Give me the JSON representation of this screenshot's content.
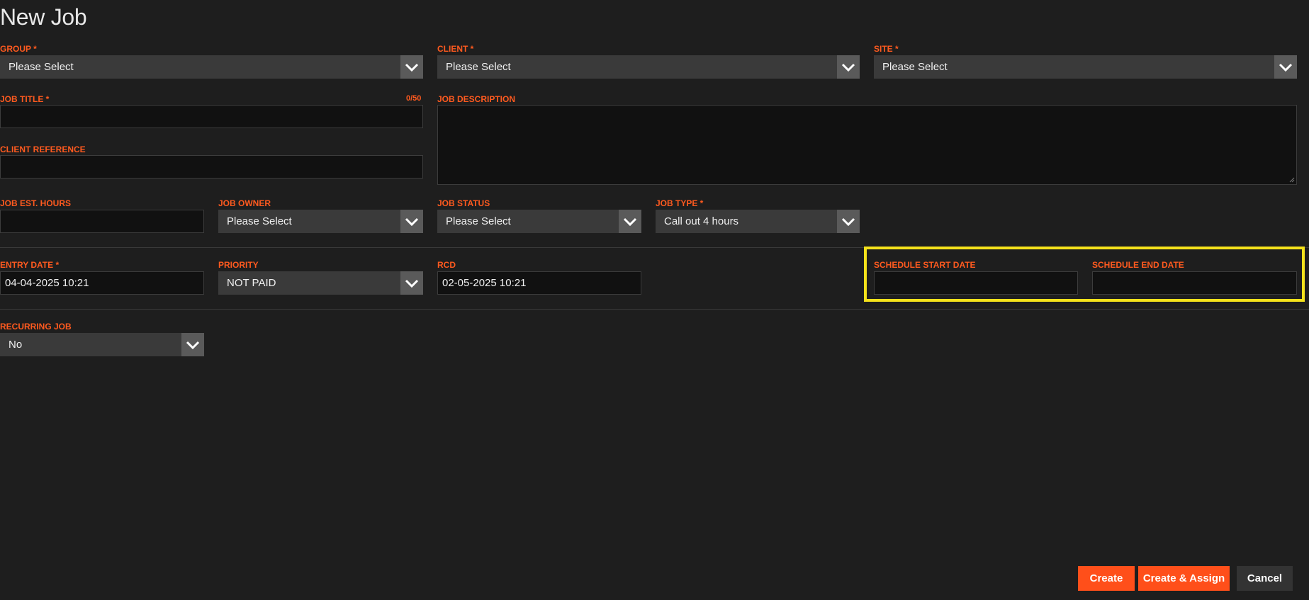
{
  "page": {
    "title": "New Job"
  },
  "fields": {
    "group": {
      "label": "GROUP *",
      "value": "Please Select"
    },
    "client": {
      "label": "CLIENT *",
      "value": "Please Select"
    },
    "site": {
      "label": "SITE *",
      "value": "Please Select"
    },
    "job_title": {
      "label": "JOB TITLE *",
      "counter": "0/50",
      "value": ""
    },
    "job_description": {
      "label": "JOB DESCRIPTION",
      "value": ""
    },
    "client_reference": {
      "label": "CLIENT REFERENCE",
      "value": ""
    },
    "job_est_hours": {
      "label": "JOB EST. HOURS",
      "value": ""
    },
    "job_owner": {
      "label": "JOB OWNER",
      "value": "Please Select"
    },
    "job_status": {
      "label": "JOB STATUS",
      "value": "Please Select"
    },
    "job_type": {
      "label": "JOB TYPE *",
      "value": "Call out 4 hours"
    },
    "entry_date": {
      "label": "ENTRY DATE *",
      "value": "04-04-2025 10:21"
    },
    "priority": {
      "label": "PRIORITY",
      "value": "NOT PAID"
    },
    "rcd": {
      "label": "RCD",
      "value": "02-05-2025 10:21"
    },
    "schedule_start_date": {
      "label": "SCHEDULE START DATE",
      "value": ""
    },
    "schedule_end_date": {
      "label": "SCHEDULE END DATE",
      "value": ""
    },
    "recurring_job": {
      "label": "RECURRING JOB",
      "value": "No"
    }
  },
  "actions": {
    "create": "Create",
    "create_assign": "Create & Assign",
    "cancel": "Cancel"
  },
  "colors": {
    "background": "#1e1e1e",
    "label": "#ff5a1f",
    "select_bg": "#3a3a3a",
    "input_bg": "#111111",
    "primary_button": "#ff4f1a",
    "highlight": "#f5e21b"
  },
  "icons": {
    "dropdown": "chevron-down-icon"
  }
}
